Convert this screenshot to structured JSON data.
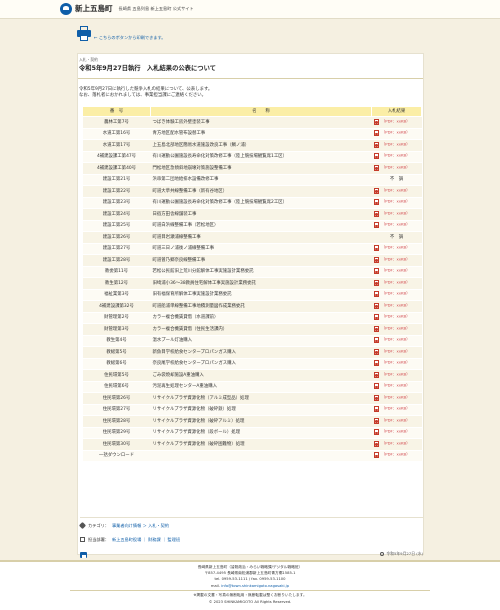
{
  "header": {
    "logo_text": "新上五島町",
    "subtitle": "長崎県 五島列島 新上五島町 公式サイト"
  },
  "print": {
    "note": "← こちらのボタンから印刷できます。"
  },
  "article": {
    "category": "入札・契約",
    "title": "令和5年9月27日執行　入札結果の公表について",
    "intro_1": "令和5年9月27日に執行した競争入札の結果について、公表します。",
    "intro_2": "なお、落札者におかれましては、事業担当課にご連絡ください。"
  },
  "table": {
    "headers": [
      "番　号",
      "名　　称",
      "入札結果"
    ],
    "rows": [
      {
        "num": "農林工第7号",
        "name": "つばき体験工房外壁塗装工事",
        "result": "pdf",
        "label": "（PDF：xxKB）"
      },
      {
        "num": "水道工第16号",
        "name": "青方地区配水管布設替工事",
        "result": "pdf",
        "label": "（PDF：xxKB）"
      },
      {
        "num": "水道工第17号",
        "name": "上五島北部地区簡易水道施設改良工事（鯛ノ浦）",
        "result": "pdf",
        "label": "（PDF：xxKB）"
      },
      {
        "num": "4補建設課工第47号",
        "name": "有川運動公園施設長寿命化対策改修工事（陸上競技場観覧席1工区）",
        "result": "pdf",
        "label": "（PDF：xxKB）"
      },
      {
        "num": "4補建設課工第40号",
        "name": "門松地区急傾斜地崩壊対策施設整備工事",
        "result": "pdf",
        "label": "（PDF：xxKB）"
      },
      {
        "num": "建設工第21号",
        "name": "浜串第二団地給排水設備改修工事",
        "result": "text",
        "label": "不　調"
      },
      {
        "num": "建設工第22号",
        "name": "町道大草共線整備工事（新有谷地区）",
        "result": "pdf",
        "label": "（PDF：xxKB）"
      },
      {
        "num": "建設工第23号",
        "name": "有川運動公園施設長寿命化対策改修工事（陸上競技場観覧席2工区）",
        "result": "pdf",
        "label": "（PDF：xxKB）"
      },
      {
        "num": "建設工第24号",
        "name": "日宿方田舎線舗装工事",
        "result": "pdf",
        "label": "（PDF：xxKB）"
      },
      {
        "num": "建設工第25号",
        "name": "町道白浜線整備工事（若松地区）",
        "result": "pdf",
        "label": "（PDF：xxKB）"
      },
      {
        "num": "建設工第26号",
        "name": "町道目岩瀬浦線整備工事",
        "result": "text",
        "label": "不　調"
      },
      {
        "num": "建設工第27号",
        "name": "町道三日ノ浦後ノ浦線整備工事",
        "result": "pdf",
        "label": "（PDF：xxKB）"
      },
      {
        "num": "建設工第28号",
        "name": "町道曽乃郷奈良線整備工事",
        "result": "pdf",
        "label": "（PDF：xxKB）"
      },
      {
        "num": "教委第11号",
        "name": "若松公民館旧上荒川分館解体工事実施設計業務委託",
        "result": "pdf",
        "label": "（PDF：xxKB）"
      },
      {
        "num": "教生第12号",
        "name": "旧崎浦小36～38教員住宅解体工事実施設計業務委託",
        "result": "pdf",
        "label": "（PDF：xxKB）"
      },
      {
        "num": "福祉業第3号",
        "name": "旧有福保育所解体工事実施設計業務委託",
        "result": "pdf",
        "label": "（PDF：xxKB）"
      },
      {
        "num": "4補建設課第32号",
        "name": "町道船浦単線整備工事地積測量図作成業務委託",
        "result": "pdf",
        "label": "（PDF：xxKB）"
      },
      {
        "num": "財管理第2号",
        "name": "カラー複合機賃貸借（水道課前）",
        "result": "pdf",
        "label": "（PDF：xxKB）"
      },
      {
        "num": "財管理第3号",
        "name": "カラー複合機賃貸借（住民生活課内）",
        "result": "pdf",
        "label": "（PDF：xxKB）"
      },
      {
        "num": "教生第4号",
        "name": "温水プール灯油購入",
        "result": "pdf",
        "label": "（PDF：xxKB）"
      },
      {
        "num": "教総第5号",
        "name": "新魚目学校給食センタープロパンガス購入",
        "result": "pdf",
        "label": "（PDF：xxKB）"
      },
      {
        "num": "教総第6号",
        "name": "奈良尾学校給食センタープロパンガス購入",
        "result": "pdf",
        "label": "（PDF：xxKB）"
      },
      {
        "num": "住民環第5号",
        "name": "ごみ袋焼却施設A重油購入",
        "result": "pdf",
        "label": "（PDF：xxKB）"
      },
      {
        "num": "住民環第6号",
        "name": "汚泥再生処理センターA重油購入",
        "result": "pdf",
        "label": "（PDF：xxKB）"
      },
      {
        "num": "住民環第26号",
        "name": "リサイクルプラザ資源化物（アルミ成型品）処理",
        "result": "pdf",
        "label": "（PDF：xxKB）"
      },
      {
        "num": "住民環第27号",
        "name": "リサイクルプラザ資源化物（破砕鉄）処理",
        "result": "pdf",
        "label": "（PDF：xxKB）"
      },
      {
        "num": "住民環第28号",
        "name": "リサイクルプラザ資源化物（破砕アルミ）処理",
        "result": "pdf",
        "label": "（PDF：xxKB）"
      },
      {
        "num": "住民環第29号",
        "name": "リサイクルプラザ資源化物（段ボール）処理",
        "result": "pdf",
        "label": "（PDF：xxKB）"
      },
      {
        "num": "住民環第30号",
        "name": "リサイクルプラザ資源化物（破砕困難物）処理",
        "result": "pdf",
        "label": "（PDF：xxKB）"
      },
      {
        "num": "一括ダウンロード",
        "name": "",
        "result": "pdf",
        "label": "（PDF：xxKB）"
      }
    ]
  },
  "tags": {
    "category_label": "カテゴリ：",
    "category_links": "事業者向け情報 ＞ 入札・契約",
    "dept_label": "担当部署：",
    "dept_links": "新上五島町役場 ｜ 財務課 ｜ 監理班"
  },
  "updated": "令和5年9月27日 (水)",
  "footer": {
    "line1": "長崎県新上五島町（皆既政治・みらい戦略課/デジタル戦略班）",
    "line2": "〒857-4495 長崎県南松浦郡新上五島町青方郷1585-1",
    "line3": "tel. 0959-53-1111 / fax. 0959-53-1100",
    "mail_label": "mail. ",
    "mail": "info@town.shinkamigoto.nagasaki.jp",
    "note": "※掲載の文書・写真の無断転用・無断転載は堅くお断りいたします。",
    "copyright": "© 2023 SHINKAMIGOTO All Rights Reserved."
  }
}
